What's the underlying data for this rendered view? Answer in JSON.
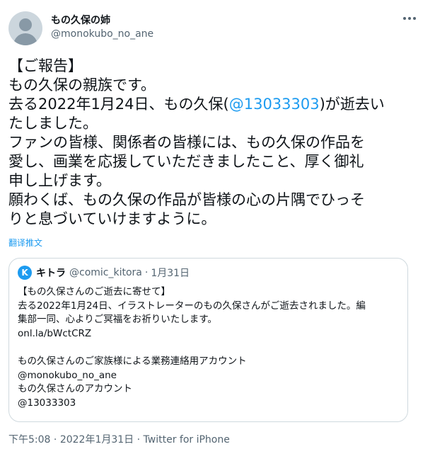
{
  "author": {
    "name": "もの久保の姉",
    "handle": "@monokubo_no_ane"
  },
  "icons": {
    "more": "more-horizontal-icon",
    "avatar": "default-avatar-icon",
    "quote_avatar_letter": "K"
  },
  "tweet": {
    "l1": "【ご報告】",
    "l2": "もの久保の親族です。",
    "l3_pre": "去る2022年1月24日、もの久保(",
    "l3_mention": "@13033303",
    "l3_post": ")が逝去い",
    "l4": "たしました。",
    "l5": "ファンの皆様、関係者の皆様には、もの久保の作品を",
    "l6": "愛し、画業を応援していただきましたこと、厚く御礼",
    "l7": "申し上げます。",
    "l8": "願わくば、もの久保の作品が皆様の心の片隅でひっそ",
    "l9": "りと息づいていけますように。"
  },
  "translate_label": "翻译推文",
  "quote": {
    "name": "キトラ",
    "handle": "@comic_kitora",
    "separator": "·",
    "date": "1月31日",
    "lines": [
      "【もの久保さんのご逝去に寄せて】",
      "去る2022年1月24日、イラストレーターのもの久保さんがご逝去されました。編",
      "集部一同、心よりご冥福をお祈りいたします。",
      "onl.la/bWctCRZ",
      "",
      "もの久保さんのご家族様による業務連絡用アカウント",
      "@monokubo_no_ane",
      "もの久保さんのアカウント",
      "@13033303"
    ]
  },
  "meta": {
    "time": "下午5:08",
    "sep1": " · ",
    "date": "2022年1月31日",
    "sep2": " · ",
    "source": "Twitter for iPhone"
  },
  "colors": {
    "accent": "#1d9bf0",
    "text": "#0f1419",
    "secondary": "#536471",
    "border": "#cfd9de"
  }
}
